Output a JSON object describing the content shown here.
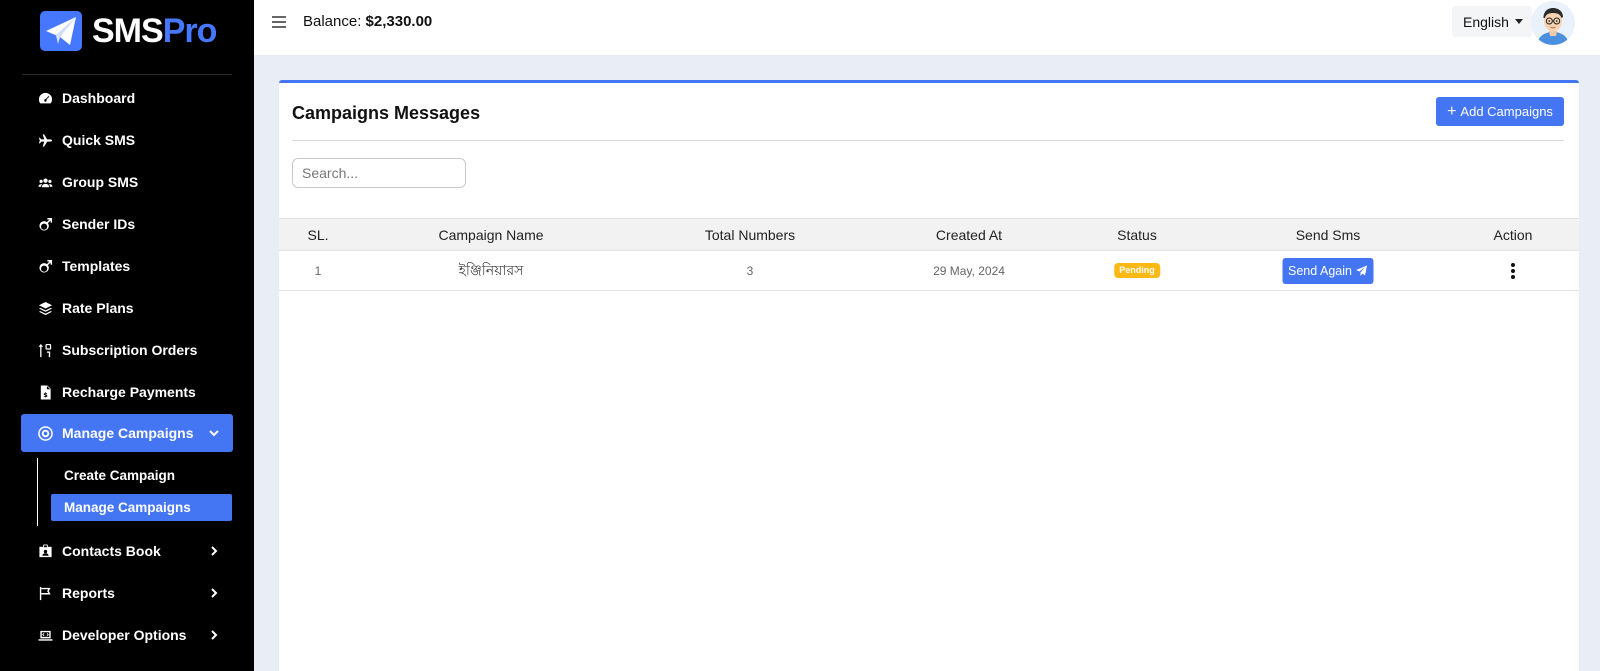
{
  "brand": {
    "name_part1": "SMS",
    "name_part2": "Pro",
    "accent": "#4577ff"
  },
  "sidebar": {
    "items": [
      {
        "label": "Dashboard",
        "icon": "speedometer-icon"
      },
      {
        "label": "Quick SMS",
        "icon": "plane-icon"
      },
      {
        "label": "Group SMS",
        "icon": "users-icon"
      },
      {
        "label": "Sender IDs",
        "icon": "mars-icon"
      },
      {
        "label": "Templates",
        "icon": "mars-icon"
      },
      {
        "label": "Rate Plans",
        "icon": "layers-icon"
      },
      {
        "label": "Subscription Orders",
        "icon": "sort-icon"
      },
      {
        "label": "Recharge Payments",
        "icon": "invoice-icon"
      },
      {
        "label": "Manage Campaigns",
        "icon": "bullseye-icon",
        "expanded": true
      },
      {
        "label": "Contacts Book",
        "icon": "contact-card-icon"
      },
      {
        "label": "Reports",
        "icon": "flag-icon"
      },
      {
        "label": "Developer Options",
        "icon": "laptop-code-icon"
      }
    ],
    "submenu": [
      {
        "label": "Create Campaign"
      },
      {
        "label": "Manage Campaigns",
        "active": true
      }
    ]
  },
  "topbar": {
    "balance_label": "Balance:",
    "balance_value": "$2,330.00",
    "language": "English"
  },
  "card": {
    "title": "Campaigns Messages",
    "add_button": "Add Campaigns",
    "search_placeholder": "Search..."
  },
  "table": {
    "headers": [
      "SL.",
      "Campaign Name",
      "Total Numbers",
      "Created At",
      "Status",
      "Send Sms",
      "Action"
    ],
    "rows": [
      {
        "sl": "1",
        "name": "ইঞ্জিনিয়ারস",
        "total": "3",
        "created": "29 May, 2024",
        "status": "Pending",
        "send_label": "Send Again"
      }
    ]
  },
  "colors": {
    "primary": "#4475f2",
    "pending": "#fdb913",
    "sidebar_bg": "#000000",
    "page_bg": "#e9eef6"
  }
}
